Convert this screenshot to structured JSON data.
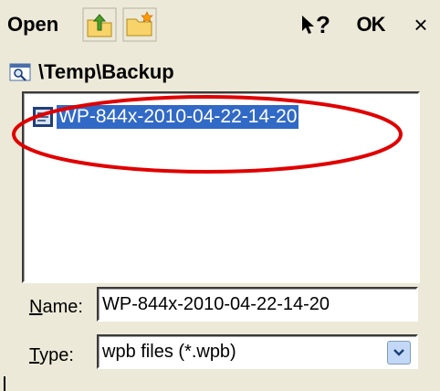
{
  "window": {
    "title": "Open",
    "help_label": "?",
    "ok_label": "OK",
    "close_label": "×"
  },
  "icons": {
    "up_folder": "folder-up-icon",
    "new_folder": "new-folder-icon",
    "help": "help-pointer-icon",
    "path": "folder-search-icon",
    "file": "file-icon"
  },
  "path": {
    "text": "\\Temp\\Backup"
  },
  "file_list": {
    "items": [
      {
        "name": "WP-844x-2010-04-22-14-20",
        "selected": true
      }
    ]
  },
  "fields": {
    "name_label": "Name:",
    "name_value": "WP-844x-2010-04-22-14-20",
    "type_label": "Type:",
    "type_value": "wpb files (*.wpb)"
  },
  "colors": {
    "dialog_bg": "#ece9d8",
    "selection": "#3169c6",
    "annotation": "#e00000"
  }
}
